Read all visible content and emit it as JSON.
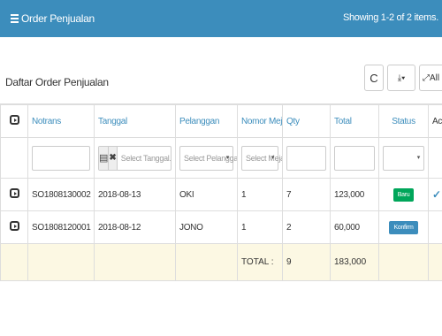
{
  "header": {
    "title": "Order Penjualan",
    "summary": "Showing 1-2 of 2 items."
  },
  "subheader": {
    "title": "Daftar Order Penjualan",
    "refresh_icon": "C",
    "all_label": "All"
  },
  "columns": [
    "Notrans",
    "Tanggal",
    "Pelanggan",
    "Nomor Meja",
    "Qty",
    "Total",
    "Status",
    "Actions"
  ],
  "filters": {
    "tanggal_placeholder": "Select Tanggal.",
    "pelanggan_placeholder": "Select Pelanggan",
    "meja_placeholder": "Select Meja"
  },
  "rows": [
    {
      "notrans": "SO1808130002",
      "tanggal": "2018-08-13",
      "pelanggan": "OKI",
      "meja": "1",
      "qty": "7",
      "total": "123,000",
      "status": "Baru",
      "status_color": "#00a65a"
    },
    {
      "notrans": "SO1808120001",
      "tanggal": "2018-08-12",
      "pelanggan": "JONO",
      "meja": "1",
      "qty": "2",
      "total": "60,000",
      "status": "Konfirm",
      "status_color": "#3c8dbc"
    }
  ],
  "totals": {
    "label": "TOTAL :",
    "qty": "9",
    "total": "183,000"
  },
  "colors": {
    "header_bg": "#3c8dbc",
    "total_row_bg": "#fcf8e3"
  }
}
